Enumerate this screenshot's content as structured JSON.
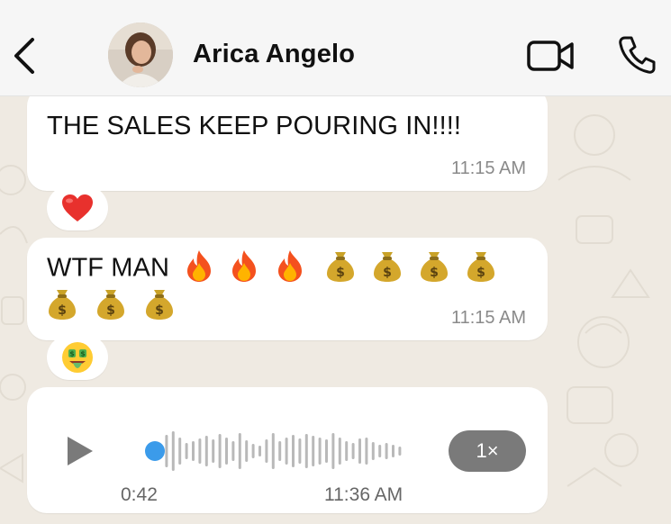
{
  "header": {
    "contact_name": "Arica Angelo",
    "back_icon": "chevron-left-icon",
    "video_icon": "video-camera-icon",
    "call_icon": "phone-icon"
  },
  "messages": [
    {
      "text": "THE SALES KEEP POURING IN!!!!",
      "time": "11:15 AM",
      "reaction": "heart-emoji"
    },
    {
      "text": "WTF MAN",
      "emoji_line1": [
        "fire",
        "fire",
        "fire",
        "money-bag",
        "money-bag",
        "money-bag",
        "money-bag"
      ],
      "emoji_line2": [
        "money-bag",
        "money-bag",
        "money-bag"
      ],
      "time": "11:15 AM",
      "reaction": "money-mouth-face-emoji"
    },
    {
      "type": "voice",
      "duration": "0:42",
      "time": "11:36 AM",
      "speed": "1×",
      "progress": 0
    }
  ],
  "colors": {
    "background": "#efeae2",
    "bubble": "#ffffff",
    "accent_blue": "#3b9bea",
    "speed_pill": "#7a7a7a"
  }
}
